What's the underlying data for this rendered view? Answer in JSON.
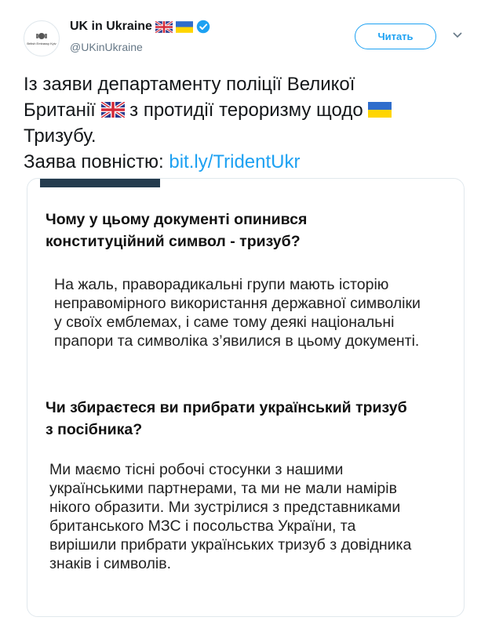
{
  "header": {
    "display_name": "UK in Ukraine",
    "handle": "@UKinUkraine",
    "follow_label": "Читать",
    "avatar_text": "British Embassy Kyiv"
  },
  "tweet": {
    "line1": "Із заяви департаменту поліції Великої",
    "line2a": "Британії ",
    "line2b": " з протидії тероризму щодо ",
    "line3": " Тризубу.",
    "line4_prefix": "Заява повністю: ",
    "link": "bit.ly/TridentUkr"
  },
  "card": {
    "question1": "Чому у цьому документі опинився конституційний символ - тризуб?",
    "answer1": "На жаль, праворадикальні групи мають історію неправомірного використання державної символіки у своїх емблемах, і саме тому деякі національні прапори та символіка з’явилися в цьому документі.",
    "question2": "Чи збираєтеся ви прибрати український тризуб з посібника?",
    "answer2": "Ми маємо тісні робочі стосунки з нашими українськими партнерами, та ми не мали намірів нікого образити.  Ми зустрілися з представниками британського МЗС і посольства України, та вирішили прибрати українських тризуб з довідника знаків і символів."
  },
  "colors": {
    "accent": "#1da1f2",
    "card_bar": "#243b4e",
    "ua_blue": "#2f6dcc",
    "ua_yellow": "#ffd500",
    "uk_blue": "#2a3a8c",
    "uk_red": "#d52b3a"
  },
  "icons": [
    "uk-flag-icon",
    "ukraine-flag-icon",
    "verified-badge-icon",
    "chevron-down-icon"
  ]
}
